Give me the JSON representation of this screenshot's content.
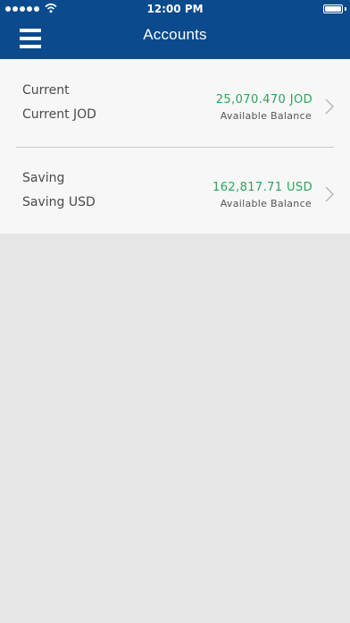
{
  "status_bar": {
    "time": "12:00 PM"
  },
  "header": {
    "title": "Accounts",
    "menu_icon": "hamburger-menu-icon"
  },
  "accounts": [
    {
      "type": "Current",
      "name": "Current JOD",
      "balance": "25,070.470 JOD",
      "balance_label": "Available Balance"
    },
    {
      "type": "Saving",
      "name": "Saving USD",
      "balance": "162,817.71 USD",
      "balance_label": "Available Balance"
    }
  ],
  "colors": {
    "header": "#0b4a8c",
    "balance": "#2aa35c",
    "list_background": "#f7f7f7",
    "page_background": "#e6e6e6"
  }
}
